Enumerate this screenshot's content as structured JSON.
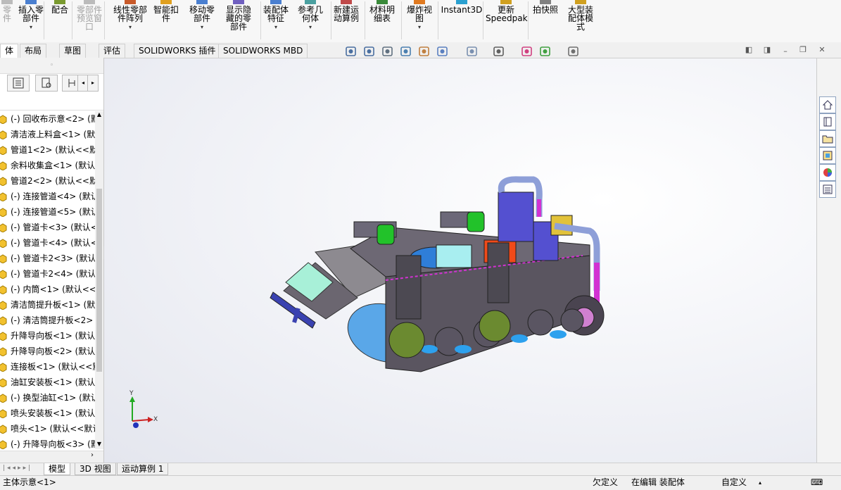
{
  "ribbon": {
    "buttons": [
      {
        "label": "零\n件",
        "dropdown": false,
        "disabled": true
      },
      {
        "label": "插入零\n部件",
        "dropdown": true,
        "disabled": false
      },
      {
        "label": "配合",
        "dropdown": false,
        "disabled": false
      },
      {
        "label": "零部件\n预览窗\n口",
        "dropdown": false,
        "disabled": true
      },
      {
        "label": "线性零部\n件阵列",
        "dropdown": true,
        "disabled": false
      },
      {
        "label": "智能扣\n件",
        "dropdown": false,
        "disabled": false
      },
      {
        "label": "移动零\n部件",
        "dropdown": true,
        "disabled": false
      },
      {
        "label": "显示隐\n藏的零\n部件",
        "dropdown": false,
        "disabled": false
      },
      {
        "label": "装配体\n特征",
        "dropdown": true,
        "disabled": false
      },
      {
        "label": "参考几\n何体",
        "dropdown": true,
        "disabled": false
      },
      {
        "label": "新建运\n动算例",
        "dropdown": false,
        "disabled": false
      },
      {
        "label": "材料明\n细表",
        "dropdown": false,
        "disabled": false
      },
      {
        "label": "爆炸视\n图",
        "dropdown": true,
        "disabled": false
      },
      {
        "label": "Instant3D",
        "dropdown": false,
        "disabled": false
      },
      {
        "label": "更新\nSpeedpak",
        "dropdown": false,
        "disabled": false
      },
      {
        "label": "拍快照",
        "dropdown": false,
        "disabled": false
      },
      {
        "label": "大型装\n配体模\n式",
        "dropdown": false,
        "disabled": false
      }
    ]
  },
  "tabs": [
    {
      "label": "体",
      "active": true
    },
    {
      "label": "布局",
      "active": false
    },
    {
      "label": "草图",
      "active": false
    },
    {
      "label": "评估",
      "active": false
    },
    {
      "label": "SOLIDWORKS 插件",
      "active": false
    },
    {
      "label": "SOLIDWORKS MBD",
      "active": false
    }
  ],
  "view_toolbar": {
    "icons": [
      "zoom-to-fit-icon",
      "zoom-area-icon",
      "previous-view-icon",
      "section-view-icon",
      "dynamic-annotation-icon",
      "view-orientation-icon",
      "display-style-icon",
      "hide-show-icon",
      "edit-appearance-icon",
      "apply-scene-icon",
      "view-settings-icon"
    ]
  },
  "feature_tree": {
    "items": [
      "(-) 回收布示意<2> (默",
      "清洁液上料盒<1> (默",
      "管道1<2> (默认<<默",
      "余料收集盒<1> (默认",
      "管道2<2> (默认<<默",
      "(-) 连接管道<4> (默认",
      "(-) 连接管道<5> (默认",
      "(-) 管道卡<3> (默认<",
      "(-) 管道卡<4> (默认<",
      "(-) 管道卡2<3> (默认",
      "(-) 管道卡2<4> (默认",
      "(-) 内筒<1> (默认<<",
      "清洁筒提升板<1> (默",
      "(-) 清洁筒提升板<2>",
      "升降导向板<1> (默认",
      "升降导向板<2> (默认",
      "连接板<1> (默认<<默",
      "油缸安装板<1> (默认",
      "(-) 换型油缸<1> (默认",
      "喷头安装板<1> (默认",
      "喷头<1> (默认<<默认",
      "(-) 升降导向板<3> (默"
    ]
  },
  "bottom_tabs": [
    {
      "label": "模型",
      "active": true
    },
    {
      "label": "3D 视图",
      "active": false
    },
    {
      "label": "运动算例 1",
      "active": false
    }
  ],
  "status": {
    "left": "主体示意<1>",
    "under_defined": "欠定义",
    "editing": "在编辑 装配体",
    "custom": "自定义"
  },
  "triad": {
    "x_label": "X",
    "y_label": "Y"
  },
  "colors": {
    "body": "#5a5560",
    "accent_blue": "#5aa7e8",
    "accent_green": "#22c22a",
    "pipe": "#8e9fd8",
    "magenta": "#d232d2"
  }
}
